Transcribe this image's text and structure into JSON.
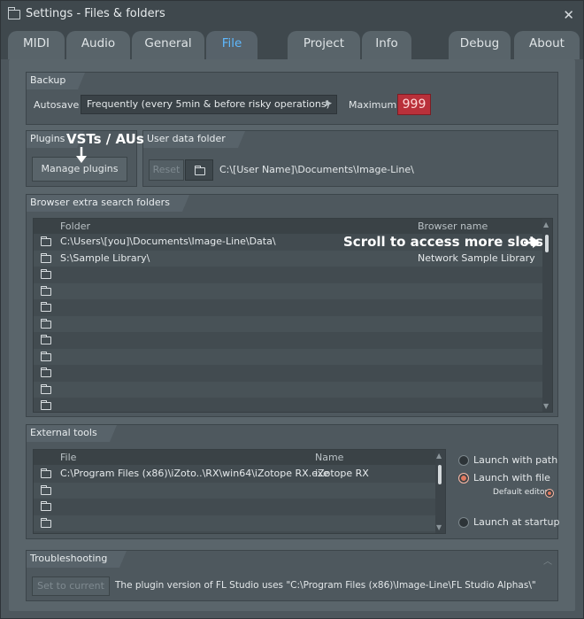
{
  "window": {
    "title": "Settings - Files & folders"
  },
  "tabs": [
    {
      "label": "MIDI"
    },
    {
      "label": "Audio"
    },
    {
      "label": "General"
    },
    {
      "label": "File"
    },
    {
      "label": "Project"
    },
    {
      "label": "Info"
    },
    {
      "label": "Debug"
    },
    {
      "label": "About"
    }
  ],
  "active_tab": "File",
  "backup": {
    "heading": "Backup",
    "autosave_label": "Autosave",
    "autosave_value": "Frequently (every 5min & before risky operations)",
    "maximum_label": "Maximum",
    "maximum_value": "999"
  },
  "plugins": {
    "heading": "Plugins",
    "manage_label": "Manage plugins",
    "annotation": "VSTs / AUs"
  },
  "user_data": {
    "heading": "User data folder",
    "reset_label": "Reset",
    "path": "C:\\[User Name]\\Documents\\Image-Line\\"
  },
  "browser": {
    "heading": "Browser extra search folders",
    "col_folder": "Folder",
    "col_name": "Browser name",
    "annotation": "Scroll to access more slots",
    "rows": [
      {
        "folder": "C:\\Users\\[you]\\Documents\\Image-Line\\Data\\",
        "name": ""
      },
      {
        "folder": "S:\\Sample Library\\",
        "name": "Network Sample Library"
      },
      {
        "folder": "",
        "name": ""
      },
      {
        "folder": "",
        "name": ""
      },
      {
        "folder": "",
        "name": ""
      },
      {
        "folder": "",
        "name": ""
      },
      {
        "folder": "",
        "name": ""
      },
      {
        "folder": "",
        "name": ""
      },
      {
        "folder": "",
        "name": ""
      },
      {
        "folder": "",
        "name": ""
      },
      {
        "folder": "",
        "name": ""
      }
    ]
  },
  "external": {
    "heading": "External tools",
    "col_file": "File",
    "col_name": "Name",
    "rows": [
      {
        "file": "C:\\Program Files (x86)\\iZoto..\\RX\\win64\\iZotope RX.exe",
        "name": "iZotope RX"
      },
      {
        "file": "",
        "name": ""
      },
      {
        "file": "",
        "name": ""
      },
      {
        "file": "",
        "name": ""
      }
    ],
    "launch_path": "Launch with path",
    "launch_file": "Launch with file",
    "default_editor": "Default editor",
    "launch_startup": "Launch at startup",
    "selected_option": "Launch with file"
  },
  "troubleshooting": {
    "heading": "Troubleshooting",
    "set_current_label": "Set to current",
    "message": "The plugin version of FL Studio uses \"C:\\Program Files (x86)\\Image-Line\\FL Studio Alphas\\\""
  },
  "colors": {
    "accent_tab": "#5fb9ff",
    "maximum_bg": "#b9303a",
    "radio_on": "#e2795f"
  }
}
